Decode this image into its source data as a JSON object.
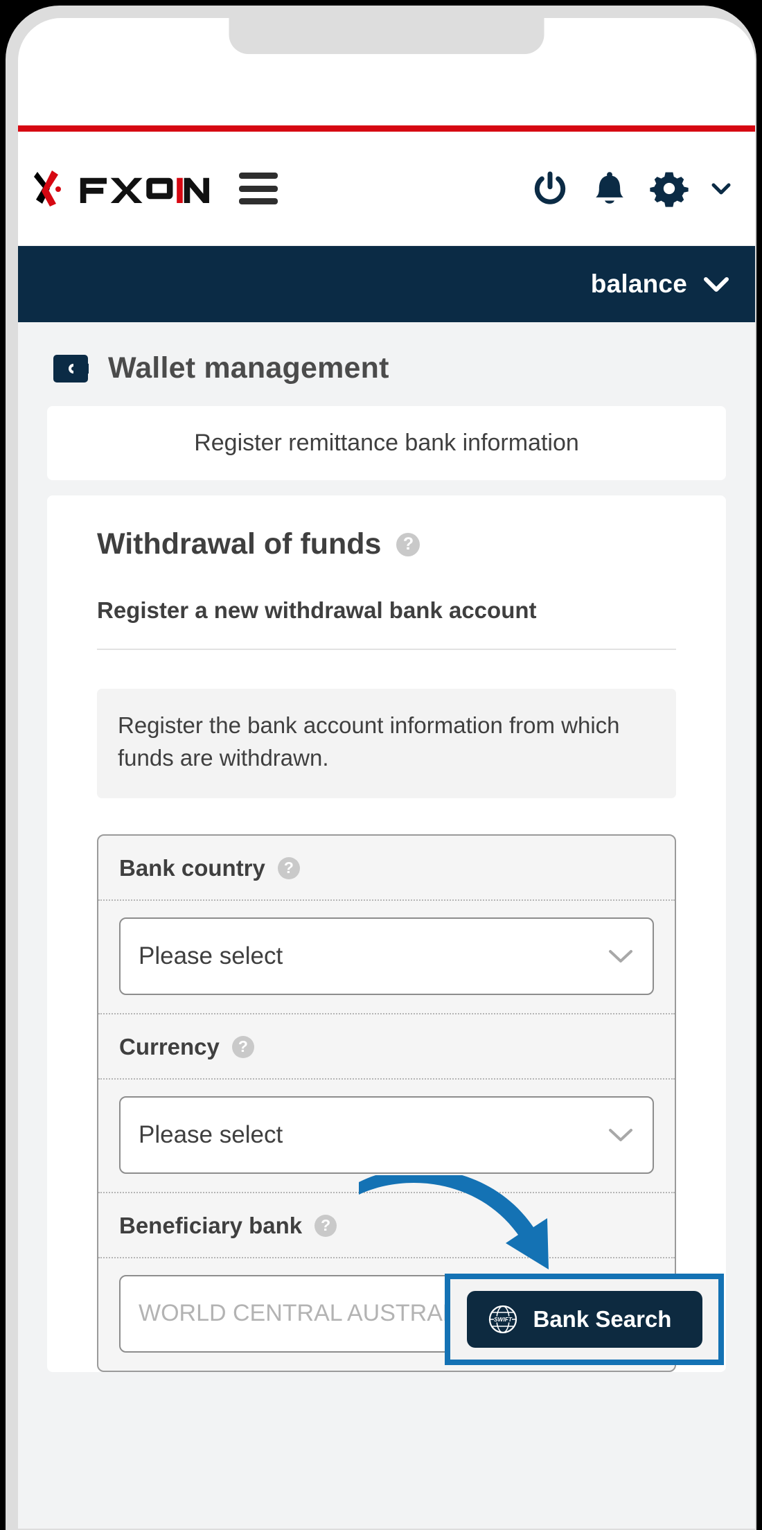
{
  "colors": {
    "accent_red": "#d60812",
    "navy": "#0b2b45",
    "button_navy": "#0d2a40",
    "highlight_blue": "#1472b4",
    "page_bg": "#f2f3f4",
    "help_gray": "#c9c9c9"
  },
  "header": {
    "logo_text": "FXON",
    "logo_icon": "fxon-x-logo-icon",
    "menu_icon": "hamburger-menu-icon",
    "icons": [
      {
        "name": "power-icon",
        "label": "power"
      },
      {
        "name": "bell-icon",
        "label": "notifications"
      },
      {
        "name": "gear-icon",
        "label": "settings"
      },
      {
        "name": "chevron-down-icon",
        "label": "expand"
      }
    ]
  },
  "balance_bar": {
    "label": "balance",
    "chevron_icon": "chevron-down-icon"
  },
  "page": {
    "icon": "wallet-icon",
    "title": "Wallet management"
  },
  "remittance_card": {
    "label": "Register remittance bank information"
  },
  "withdrawal": {
    "title": "Withdrawal of funds",
    "title_help_icon": "help-circle-icon",
    "help_glyph": "?",
    "subtitle": "Register a new withdrawal bank account",
    "info_text": "Register the bank account information from which funds are withdrawn."
  },
  "form": {
    "fields": [
      {
        "label": "Bank country",
        "help_glyph": "?",
        "type": "select",
        "value": "Please select",
        "chevron_icon": "chevron-down-icon"
      },
      {
        "label": "Currency",
        "help_glyph": "?",
        "type": "select",
        "value": "Please select",
        "chevron_icon": "chevron-down-icon"
      },
      {
        "label": "Beneficiary bank",
        "help_glyph": "?",
        "type": "text",
        "placeholder": "WORLD CENTRAL AUSTRALIA BANK CORPORA",
        "value": ""
      }
    ]
  },
  "bank_search": {
    "label": "Bank Search",
    "icon": "swift-globe-icon",
    "icon_text": "SWIFT",
    "highlight_color": "#1472b4"
  },
  "annotation": {
    "arrow": "curved-arrow-pointing-to-bank-search",
    "color": "#1472b4"
  }
}
